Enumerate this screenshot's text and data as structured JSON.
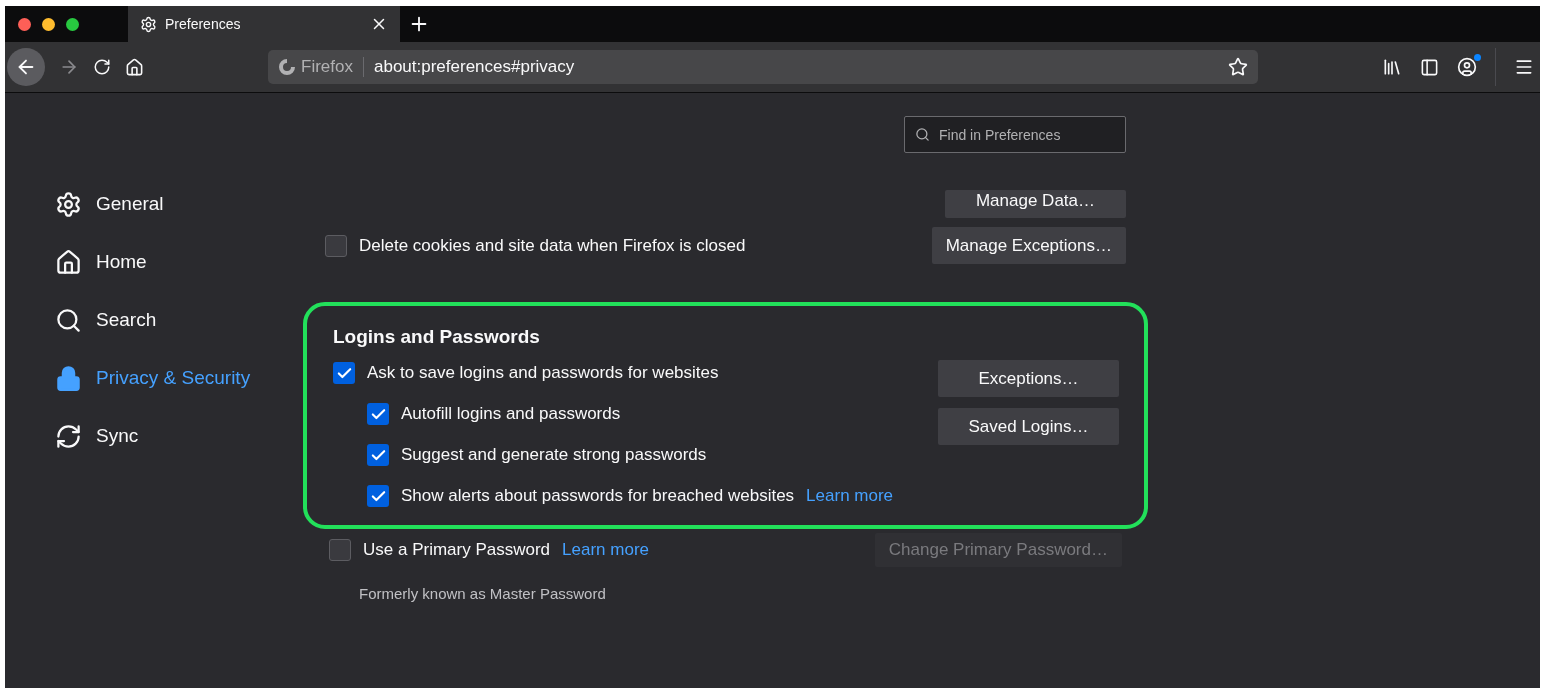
{
  "tabs": [
    {
      "label": "Preferences",
      "selected": true
    }
  ],
  "url_bar": {
    "identity": "Firefox",
    "url": "about:preferences#privacy"
  },
  "account_badge": true,
  "search": {
    "placeholder": "Find in Preferences"
  },
  "sidebar": {
    "items": [
      {
        "label": "General",
        "selected": false
      },
      {
        "label": "Home",
        "selected": false
      },
      {
        "label": "Search",
        "selected": false
      },
      {
        "label": "Privacy & Security",
        "selected": true
      },
      {
        "label": "Sync",
        "selected": false
      }
    ]
  },
  "cookies": {
    "buttons": [
      {
        "label": "Manage Data…",
        "disabled": false
      },
      {
        "label": "Manage Exceptions…",
        "disabled": false
      }
    ],
    "delete_on_close": {
      "label": "Delete cookies and site data when Firefox is closed",
      "checked": false
    }
  },
  "logins": {
    "title": "Logins and Passwords",
    "highlighted": true,
    "options": [
      {
        "label": "Ask to save logins and passwords for websites",
        "checked": true,
        "children": [
          {
            "label": "Autofill logins and passwords",
            "checked": true
          },
          {
            "label": "Suggest and generate strong passwords",
            "checked": true
          },
          {
            "label": "Show alerts about passwords for breached websites",
            "checked": true,
            "link": "Learn more"
          }
        ]
      }
    ],
    "buttons": [
      {
        "label": "Exceptions…",
        "disabled": false
      },
      {
        "label": "Saved Logins…",
        "disabled": false
      }
    ]
  },
  "primary_password": {
    "label": "Use a Primary Password",
    "checked": false,
    "link": "Learn more",
    "note": "Formerly known as Master Password",
    "button": {
      "label": "Change Primary Password…",
      "disabled": true
    }
  }
}
